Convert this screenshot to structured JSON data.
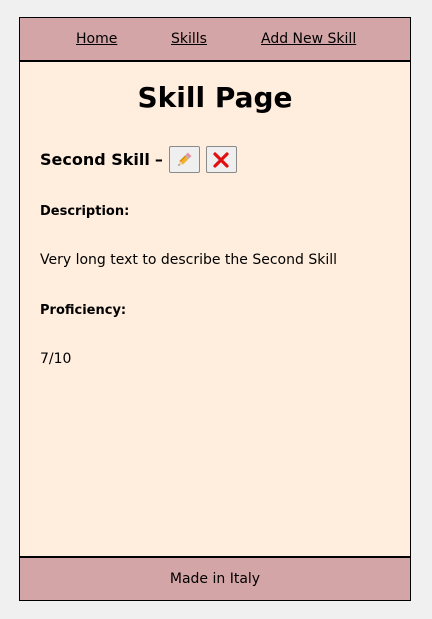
{
  "nav": {
    "home": "Home",
    "skills": "Skills",
    "add_new_skill": "Add New Skill"
  },
  "page": {
    "title": "Skill Page"
  },
  "skill": {
    "name": "Second Skill",
    "separator": "–",
    "edit_icon": "pencil-icon",
    "delete_icon": "red-x-icon",
    "description_label": "Description:",
    "description": "Very long text to describe the Second Skill",
    "proficiency_label": "Proficiency:",
    "proficiency": "7/10"
  },
  "footer": {
    "text": "Made in Italy"
  },
  "colors": {
    "bar_background": "#d4a5a6",
    "page_background": "#ffeddd",
    "delete_red": "#e01010"
  }
}
